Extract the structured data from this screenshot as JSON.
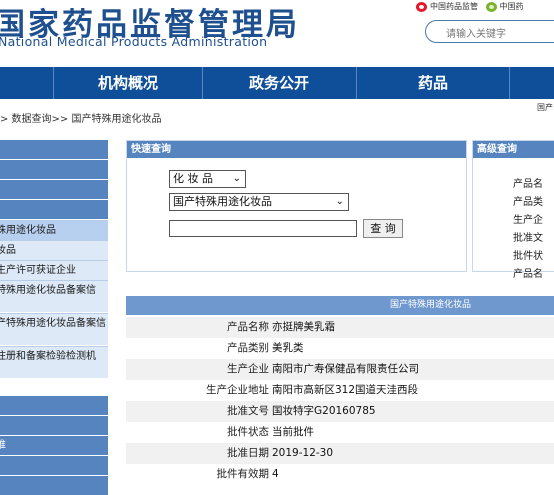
{
  "header": {
    "title_cn": "国家药品监督管理局",
    "title_en": "National Medical Products Administration",
    "link_weibo": "中国药品监管",
    "link_wechat": "中国药",
    "search_placeholder": "请输入关键字"
  },
  "nav": {
    "items": [
      "机构概况",
      "政务公开",
      "药品"
    ]
  },
  "breadcrumb": ">  数据查询>>  国产特殊用途化妆品",
  "breadcrumb_right": "国产",
  "sidebar": {
    "items": [
      "殊用途化妆品",
      "妆品",
      "生产许可获证企业",
      "特殊用途化妆品备案信",
      "产特殊用途化妆品备案信",
      "注册和备案检验检测机",
      "推"
    ]
  },
  "quick_search": {
    "heading": "快速查询",
    "category_select": "化 妆 品",
    "subcategory_select": "国产特殊用途化妆品",
    "query_button": "查 询"
  },
  "advanced_search": {
    "heading": "高级查询",
    "items": [
      "产品名",
      "产品类",
      "生产企",
      "批准文",
      "批件状",
      "产品名"
    ]
  },
  "result": {
    "heading": "国产特殊用途化妆品",
    "rows": [
      {
        "label": "产品名称",
        "value": "亦挺牌美乳霜"
      },
      {
        "label": "产品类别",
        "value": "美乳类"
      },
      {
        "label": "生产企业",
        "value": "南阳市广寿保健品有限责任公司"
      },
      {
        "label": "生产企业地址",
        "value": "南阳市高新区312国道天洼西段"
      },
      {
        "label": "批准文号",
        "value": "国妆特字G20160785"
      },
      {
        "label": "批件状态",
        "value": "当前批件"
      },
      {
        "label": "批准日期",
        "value": "2019-12-30"
      },
      {
        "label": "批件有效期",
        "value": "4"
      }
    ]
  },
  "colors": {
    "brand_blue": "#1e4f8f",
    "nav_blue": "#0f4e98",
    "panel_blue": "#5684be",
    "result_head": "#6f98cf"
  }
}
